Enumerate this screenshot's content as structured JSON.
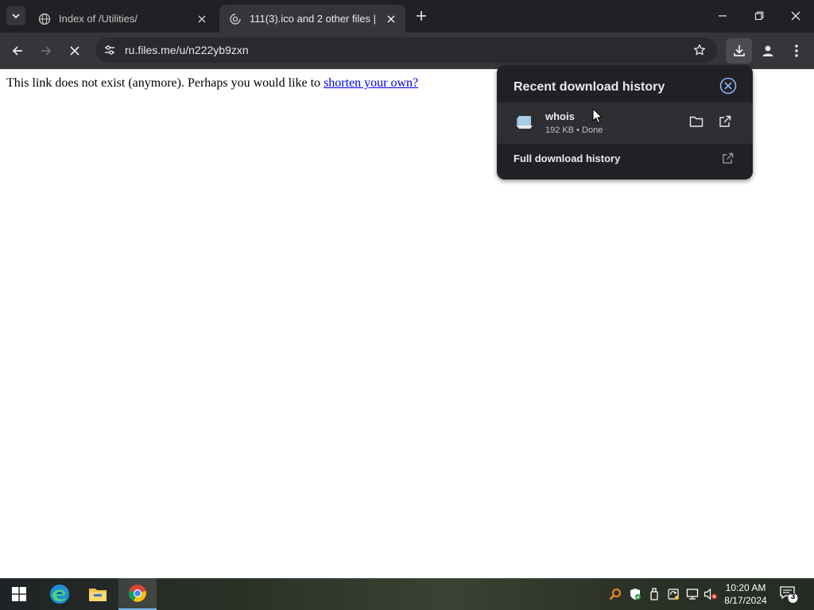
{
  "browser": {
    "tabs": [
      {
        "title": "Index of /Utilities/",
        "active": false,
        "icon": "globe-icon"
      },
      {
        "title": "111(3).ico and 2 other files | Fil",
        "active": true,
        "icon": "loading-icon"
      }
    ],
    "address": "ru.files.me/u/n222yb9zxn"
  },
  "page": {
    "message": "This link does not exist (anymore). Perhaps you would like to ",
    "link_text": "shorten your own?"
  },
  "downloads": {
    "header": "Recent download history",
    "items": [
      {
        "name": "whois",
        "status": "192 KB • Done",
        "icon": "file-icon"
      }
    ],
    "full_history_label": "Full download history"
  },
  "taskbar": {
    "time": "10:20 AM",
    "date": "8/17/2024",
    "notification_count": "3",
    "pinned": [
      "windows-start-icon",
      "edge-icon",
      "file-explorer-icon",
      "chrome-icon"
    ]
  },
  "colors": {
    "tab_strip": "#202124",
    "toolbar": "#35363a",
    "link": "#0000ee",
    "accent_blue": "#76b9ed"
  }
}
